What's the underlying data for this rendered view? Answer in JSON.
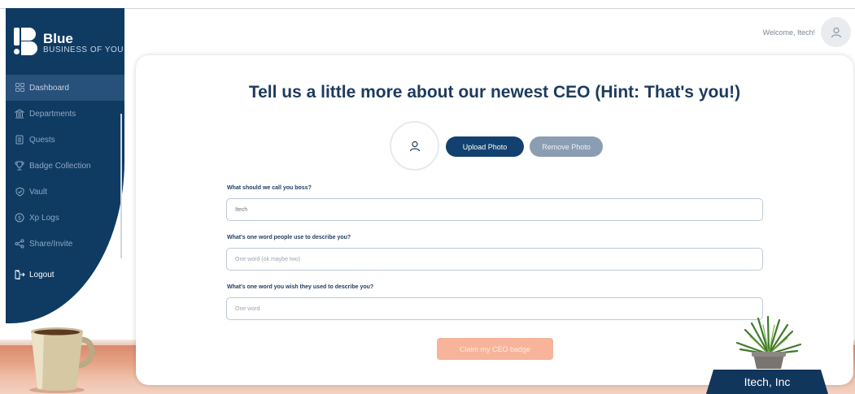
{
  "brand": {
    "title": "Blue",
    "subtitle": "BUSINESS OF YOU"
  },
  "sidebar": {
    "items": [
      {
        "label": "Dashboard",
        "icon": "grid-icon",
        "active": true
      },
      {
        "label": "Departments",
        "icon": "building-icon",
        "active": false
      },
      {
        "label": "Quests",
        "icon": "scroll-icon",
        "active": false
      },
      {
        "label": "Badge Collection",
        "icon": "trophy-icon",
        "active": false
      },
      {
        "label": "Vault",
        "icon": "shield-icon",
        "active": false
      },
      {
        "label": "Xp Logs",
        "icon": "dollar-circle-icon",
        "active": false
      },
      {
        "label": "Share/Invite",
        "icon": "share-icon",
        "active": false
      }
    ],
    "logout_label": "Logout"
  },
  "header": {
    "welcome": "Welcome, Itech!"
  },
  "form": {
    "title": "Tell us a little more about our newest CEO (Hint: That's you!)",
    "upload_label": "Upload Photo",
    "remove_label": "Remove Photo",
    "fields": [
      {
        "label": "What should we call you boss?",
        "value": "Itech",
        "placeholder": ""
      },
      {
        "label": "What's one word people use to describe you?",
        "value": "",
        "placeholder": "One word (ok maybe two)"
      },
      {
        "label": "What's one word you wish they used to describe you?",
        "value": "",
        "placeholder": "One word"
      }
    ],
    "submit_label": "Claim my CEO badge"
  },
  "nameplate": "Itech, Inc",
  "colors": {
    "sidebar": "#0f3b63",
    "primary_button": "#12416f",
    "secondary_button": "#8b9db2",
    "claim_button": "#f7b49b"
  }
}
